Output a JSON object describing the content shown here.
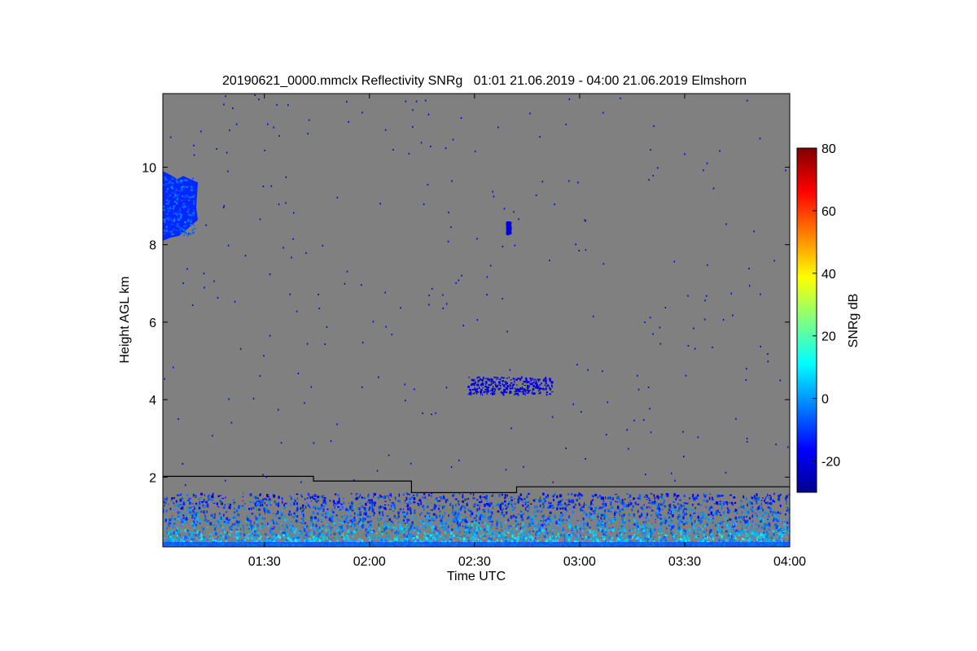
{
  "chart_data": {
    "type": "heatmap",
    "title": "20190621_0000.mmclx Reflectivity SNRg   01:01 21.06.2019 - 04:00 21.06.2019 Elmshorn",
    "xlabel": "Time UTC",
    "ylabel": "Height AGL km",
    "x_range_minutes": [
      61,
      240
    ],
    "y_range_km": [
      0.2,
      11.9
    ],
    "x_ticks": [
      {
        "minutes": 90,
        "label": "01:30"
      },
      {
        "minutes": 120,
        "label": "02:00"
      },
      {
        "minutes": 150,
        "label": "02:30"
      },
      {
        "minutes": 180,
        "label": "03:00"
      },
      {
        "minutes": 210,
        "label": "03:30"
      },
      {
        "minutes": 240,
        "label": "04:00"
      }
    ],
    "y_ticks": [
      {
        "value": 2,
        "label": "2"
      },
      {
        "value": 4,
        "label": "4"
      },
      {
        "value": 6,
        "label": "6"
      },
      {
        "value": 8,
        "label": "8"
      },
      {
        "value": 10,
        "label": "10"
      }
    ],
    "colorbar": {
      "label": "SNRg dB",
      "range": [
        -30,
        80
      ],
      "colormap": "jet",
      "ticks": [
        {
          "value": -20,
          "label": "-20"
        },
        {
          "value": 0,
          "label": "0"
        },
        {
          "value": 20,
          "label": "20"
        },
        {
          "value": 40,
          "label": "40"
        },
        {
          "value": 60,
          "label": "60"
        },
        {
          "value": 80,
          "label": "80"
        }
      ]
    },
    "background_color": "#808080",
    "boundary_line": {
      "color": "#000000",
      "points_minutes_km": [
        [
          61,
          2.02
        ],
        [
          104,
          2.02
        ],
        [
          104,
          1.9
        ],
        [
          132,
          1.9
        ],
        [
          132,
          1.6
        ],
        [
          162,
          1.6
        ],
        [
          162,
          1.75
        ],
        [
          240,
          1.75
        ]
      ]
    },
    "echo_regions": [
      {
        "feature": "upper cloud",
        "time_min": [
          61,
          71
        ],
        "height_km": [
          8.1,
          9.9
        ],
        "snr_db": -12
      },
      {
        "feature": "small cell",
        "time_min": [
          159,
          160
        ],
        "height_km": [
          8.3,
          8.6
        ],
        "snr_db": -20
      },
      {
        "feature": "mid-level cloud",
        "time_min": [
          148,
          172
        ],
        "height_km": [
          4.15,
          4.6
        ],
        "snr_db": -20
      },
      {
        "feature": "boundary layer clutter",
        "time_min": [
          61,
          240
        ],
        "height_km": [
          0.2,
          1.6
        ],
        "snr_db": [
          -25,
          15
        ]
      }
    ]
  }
}
